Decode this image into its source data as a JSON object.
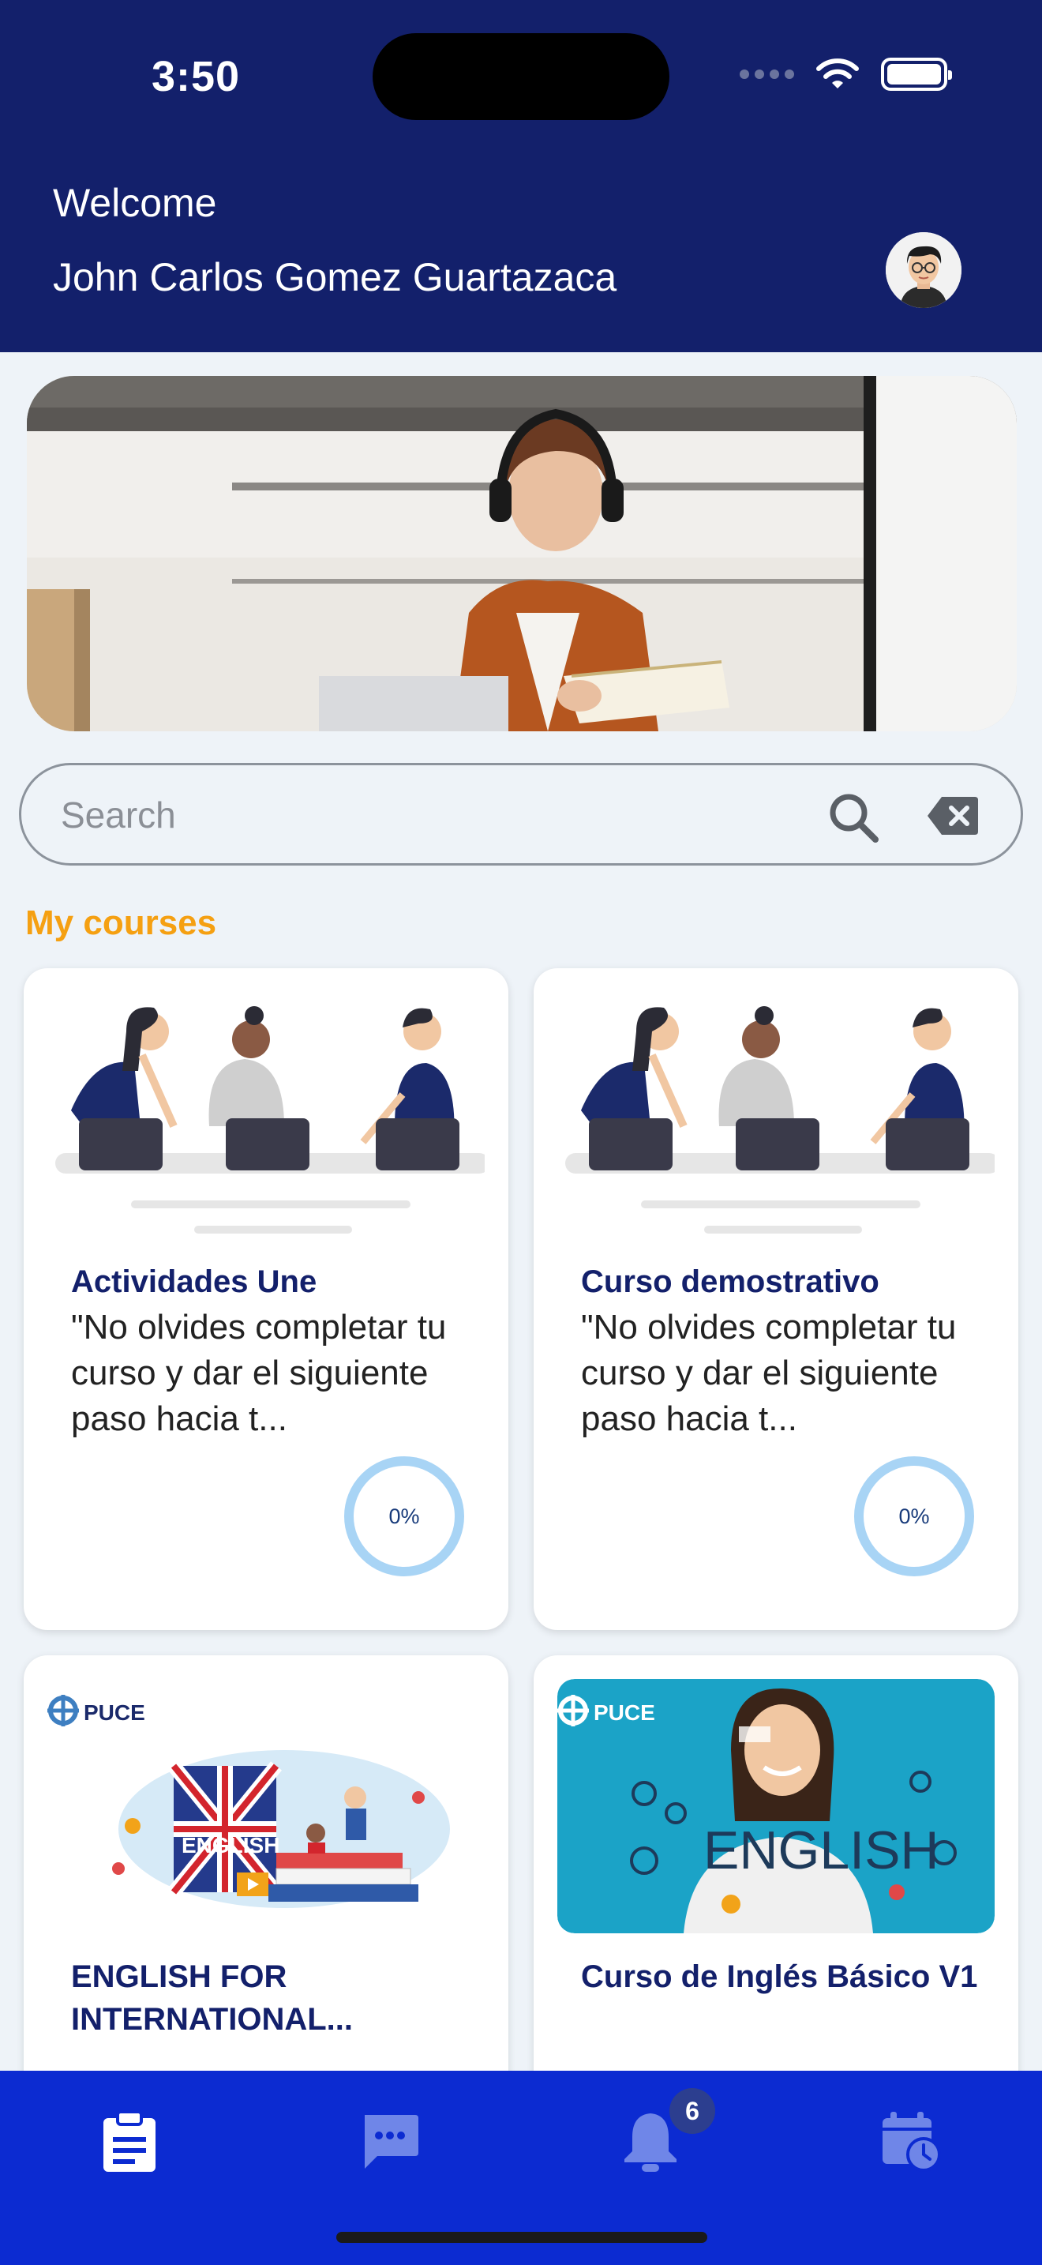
{
  "status_bar": {
    "time": "3:50"
  },
  "header": {
    "welcome": "Welcome",
    "user_name": "John Carlos Gomez Guartazaca"
  },
  "search": {
    "placeholder": "Search",
    "value": ""
  },
  "section_title": "My courses",
  "courses": [
    {
      "title": "Actividades Une",
      "description": "\"No olvides completar tu curso y dar el siguiente paso hacia t...",
      "progress": 0,
      "progress_label": "0%"
    },
    {
      "title": "Curso demostrativo",
      "description": "\"No olvides completar tu curso y dar el siguiente paso hacia t...",
      "progress": 0,
      "progress_label": "0%"
    },
    {
      "title": "ENGLISH FOR INTERNATIONAL...",
      "brand": "PUCE",
      "image_text": "ENGLISH"
    },
    {
      "title": "Curso de Inglés Básico V1",
      "brand": "PUCE",
      "image_text": "ENGLISH"
    }
  ],
  "nav": {
    "items": [
      {
        "icon": "clipboard-icon",
        "active": true
      },
      {
        "icon": "chat-icon",
        "active": false
      },
      {
        "icon": "bell-icon",
        "active": false,
        "badge": "6"
      },
      {
        "icon": "calendar-clock-icon",
        "active": false
      }
    ]
  },
  "colors": {
    "header_bg": "#13206b",
    "accent": "#f5a012",
    "nav_bg": "#0c2bd1",
    "nav_icon_inactive": "#6f86e8",
    "progress_ring": "#a8d4f5",
    "title_color": "#13206b"
  }
}
